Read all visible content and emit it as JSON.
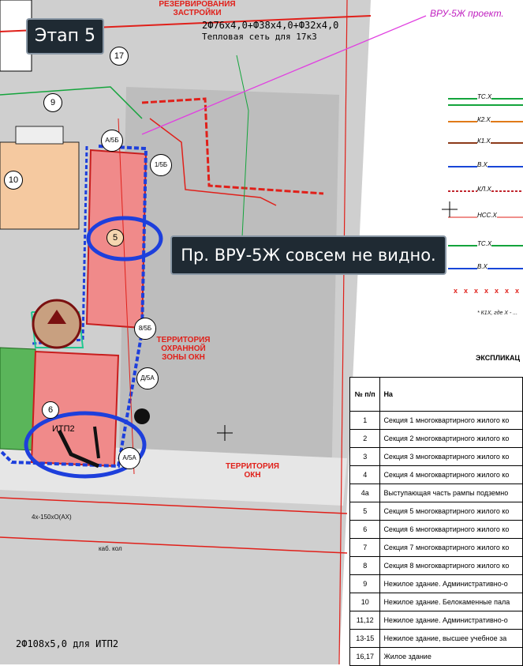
{
  "overlays": {
    "stage_label": "Этап 5",
    "note_label": "Пр. ВРУ-5Ж совсем не видно."
  },
  "map_texts": {
    "heat_net": "2Ф76x4,0+Ф38x4,0+Ф32x4,0",
    "heat_net_caption": "Тепловая сеть для 17к3",
    "vru_project": "ВРУ-5Ж проект.",
    "pipe_itp2": "2Ф108x5,0 для ИТП2",
    "itp2": "ИТП2",
    "zone_top": "РЕЗЕРВИРОВАНИЯ ЗАСТРОЙКИ",
    "zone_okn_protected": "ТЕРРИТОРИЯ ОХРАННОЙ ЗОНЫ ОКН",
    "zone_okn": "ТЕРРИТОРИЯ ОКН",
    "cable_label": "4x-150xO(AX)",
    "kab_label": "каб. кол",
    "legend_note": "* К1Х, где Х - ..."
  },
  "markers": [
    {
      "id": "17",
      "label": "17"
    },
    {
      "id": "9",
      "label": "9"
    },
    {
      "id": "10",
      "label": "10"
    },
    {
      "id": "5",
      "label": "5"
    },
    {
      "id": "6",
      "label": "6"
    },
    {
      "id": "1_5b",
      "label": "1/5Б"
    },
    {
      "id": "8_5b",
      "label": "8/5Б"
    },
    {
      "id": "d_5a",
      "label": "Д/5А"
    },
    {
      "id": "a_5a",
      "label": "А/5А"
    },
    {
      "id": "a_5b",
      "label": "А/5Б"
    }
  ],
  "legend": {
    "items": [
      {
        "code": "ТС.Х",
        "color": "#14a43c"
      },
      {
        "code": "К2.Х",
        "color": "#e07a18"
      },
      {
        "code": "К1.Х",
        "color": "#8c3a1a"
      },
      {
        "code": "В.Х",
        "color": "#1846d8"
      },
      {
        "code": "КЛ.Х",
        "color": "#c0262e"
      },
      {
        "code": "НСС.Х",
        "color": "#e0201a"
      },
      {
        "code": "ТС.Х",
        "color": "#14a43c"
      },
      {
        "code": "В.Х",
        "color": "#1846d8"
      }
    ]
  },
  "explication": {
    "title": "ЭКСПЛИКАЦ",
    "header_num": "№ п/п",
    "header_name": "На",
    "rows": [
      {
        "num": "1",
        "name": "Секция 1 многоквартирного жилого ко"
      },
      {
        "num": "2",
        "name": "Секция 2 многоквартирного жилого ко"
      },
      {
        "num": "3",
        "name": "Секция 3 многоквартирного жилого ко"
      },
      {
        "num": "4",
        "name": "Секция 4 многоквартирного жилого ко"
      },
      {
        "num": "4а",
        "name": "Выступающая часть рампы подземно"
      },
      {
        "num": "5",
        "name": "Секция 5 многоквартирного жилого ко"
      },
      {
        "num": "6",
        "name": "Секция 6 многоквартирного жилого ко"
      },
      {
        "num": "7",
        "name": "Секция 7 многоквартирного жилого ко"
      },
      {
        "num": "8",
        "name": "Секция 8 многоквартирного жилого ко"
      },
      {
        "num": "9",
        "name": "Нежилое здание. Административно-о"
      },
      {
        "num": "10",
        "name": "Нежилое здание. Белокаменные пала"
      },
      {
        "num": "11,12",
        "name": "Нежилое здание. Административно-о"
      },
      {
        "num": "13-15",
        "name": "Нежилое здание, высшее учебное за"
      },
      {
        "num": "16,17",
        "name": "Жилое здание"
      }
    ]
  }
}
